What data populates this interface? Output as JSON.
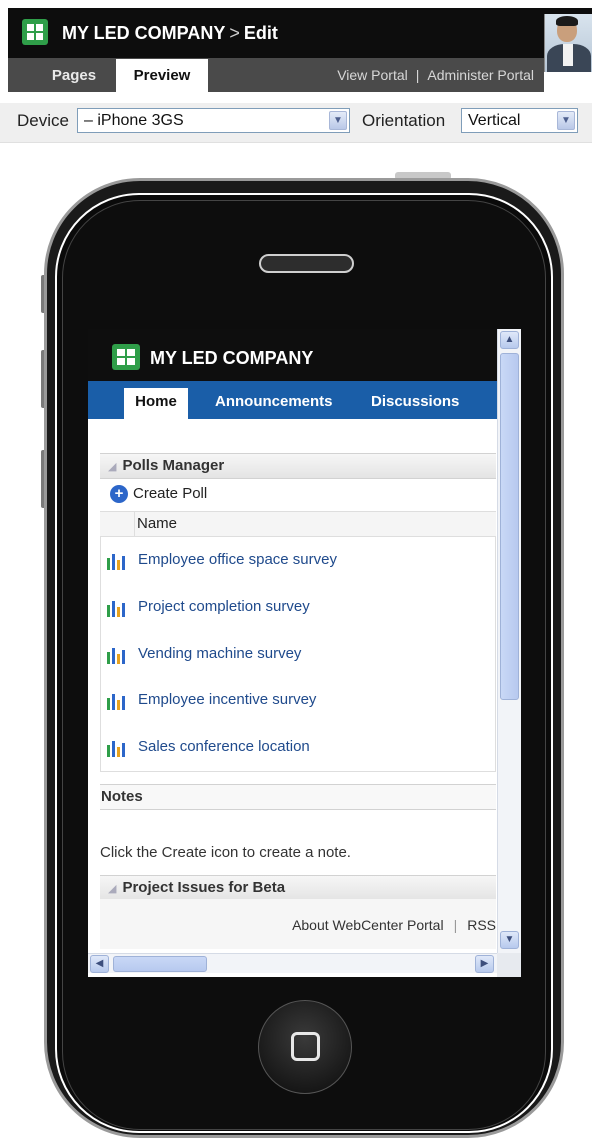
{
  "header": {
    "title": "MY LED COMPANY",
    "separator": ">",
    "subtitle": "Edit"
  },
  "nav": {
    "tabs": [
      "Pages",
      "Preview"
    ],
    "active_tab": "Preview",
    "view_portal": "View Portal",
    "divider": "|",
    "administer_portal": "Administer Portal"
  },
  "device_bar": {
    "device_label": "Device",
    "device_value": "– iPhone 3GS",
    "orientation_label": "Orientation",
    "orientation_value": "Vertical"
  },
  "preview": {
    "app_title": "MY LED COMPANY",
    "tabs": [
      "Home",
      "Announcements",
      "Discussions"
    ],
    "active_tab": "Home",
    "polls_manager": {
      "title": "Polls Manager",
      "create_label": "Create Poll",
      "column_name": "Name",
      "polls": [
        "Employee office space survey",
        "Project completion survey",
        "Vending machine survey",
        "Employee incentive survey",
        "Sales conference location"
      ]
    },
    "notes": {
      "title": "Notes",
      "empty_text": "Click the Create icon to create a note."
    },
    "project_issues": {
      "title": "Project Issues for Beta"
    },
    "footer": {
      "about": "About WebCenter Portal",
      "rss": "RSS"
    }
  },
  "colors": {
    "header_bg": "#0d0d0d",
    "nav_bg": "#4a4a4a",
    "logo_green": "#2f9e49",
    "app_tab_blue": "#1a5ea8",
    "link_blue": "#1f4a8c"
  },
  "icons": {
    "logo": "grid-logo-icon",
    "poll": "bar-chart-icon",
    "create": "plus-circle-icon",
    "collapse": "triangle-icon"
  }
}
